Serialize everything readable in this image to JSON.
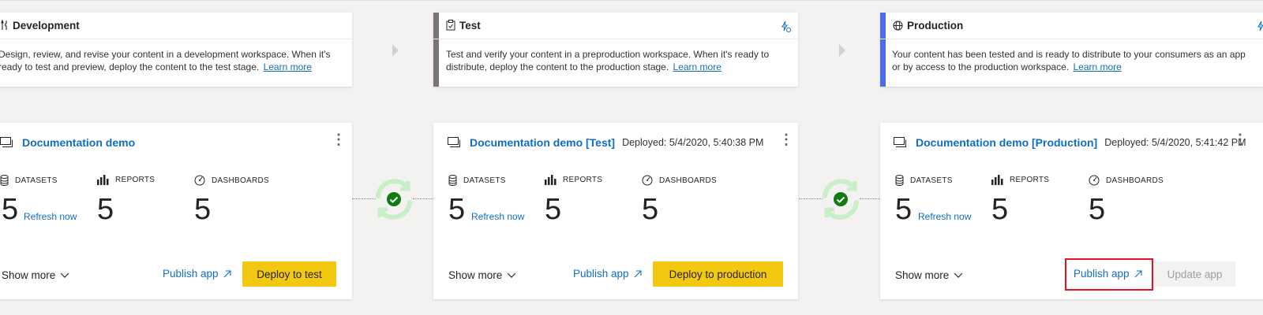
{
  "stages": [
    {
      "title": "Development",
      "icon": "tools-icon",
      "accent": "#ffffff",
      "desc_line1": "Design, review, and revise your content in a development workspace. When it's",
      "desc_line2": "ready to test and preview, deploy the content to the test stage.",
      "learn_more": "Learn more"
    },
    {
      "title": "Test",
      "icon": "clipboard-check-icon",
      "accent": "#7a7574",
      "desc_line1": "Test and verify your content in a preproduction workspace. When it's ready to",
      "desc_line2": "distribute, deploy the content to the production stage.",
      "learn_more": "Learn more"
    },
    {
      "title": "Production",
      "icon": "globe-icon",
      "accent": "#4f6bed",
      "desc_line1": "Your content has been tested and is ready to distribute to your consumers as an app",
      "desc_line2": "or by access to the production workspace.",
      "learn_more": "Learn more"
    }
  ],
  "workspaces": [
    {
      "name": "Documentation demo",
      "deployed": "",
      "metrics": {
        "datasets_label": "DATASETS",
        "datasets": "5",
        "refresh": "Refresh now",
        "reports_label": "REPORTS",
        "reports": "5",
        "dashboards_label": "DASHBOARDS",
        "dashboards": "5"
      },
      "show_more": "Show more",
      "publish": "Publish app",
      "action": "Deploy to test"
    },
    {
      "name": "Documentation demo [Test]",
      "deployed": "Deployed: 5/4/2020, 5:40:38 PM",
      "metrics": {
        "datasets_label": "DATASETS",
        "datasets": "5",
        "refresh": "Refresh now",
        "reports_label": "REPORTS",
        "reports": "5",
        "dashboards_label": "DASHBOARDS",
        "dashboards": "5"
      },
      "show_more": "Show more",
      "publish": "Publish app",
      "action": "Deploy to production"
    },
    {
      "name": "Documentation demo [Production]",
      "deployed": "Deployed: 5/4/2020, 5:41:42 PM",
      "metrics": {
        "datasets_label": "DATASETS",
        "datasets": "5",
        "refresh": "Refresh now",
        "reports_label": "REPORTS",
        "reports": "5",
        "dashboards_label": "DASHBOARDS",
        "dashboards": "5"
      },
      "show_more": "Show more",
      "publish": "Publish app",
      "action": "Update app"
    }
  ],
  "more_glyph": "⋮",
  "colors": {
    "link": "#106ebe",
    "primary_button": "#f2c811",
    "sync_ok": "#107c10",
    "highlight": "#e81123"
  }
}
